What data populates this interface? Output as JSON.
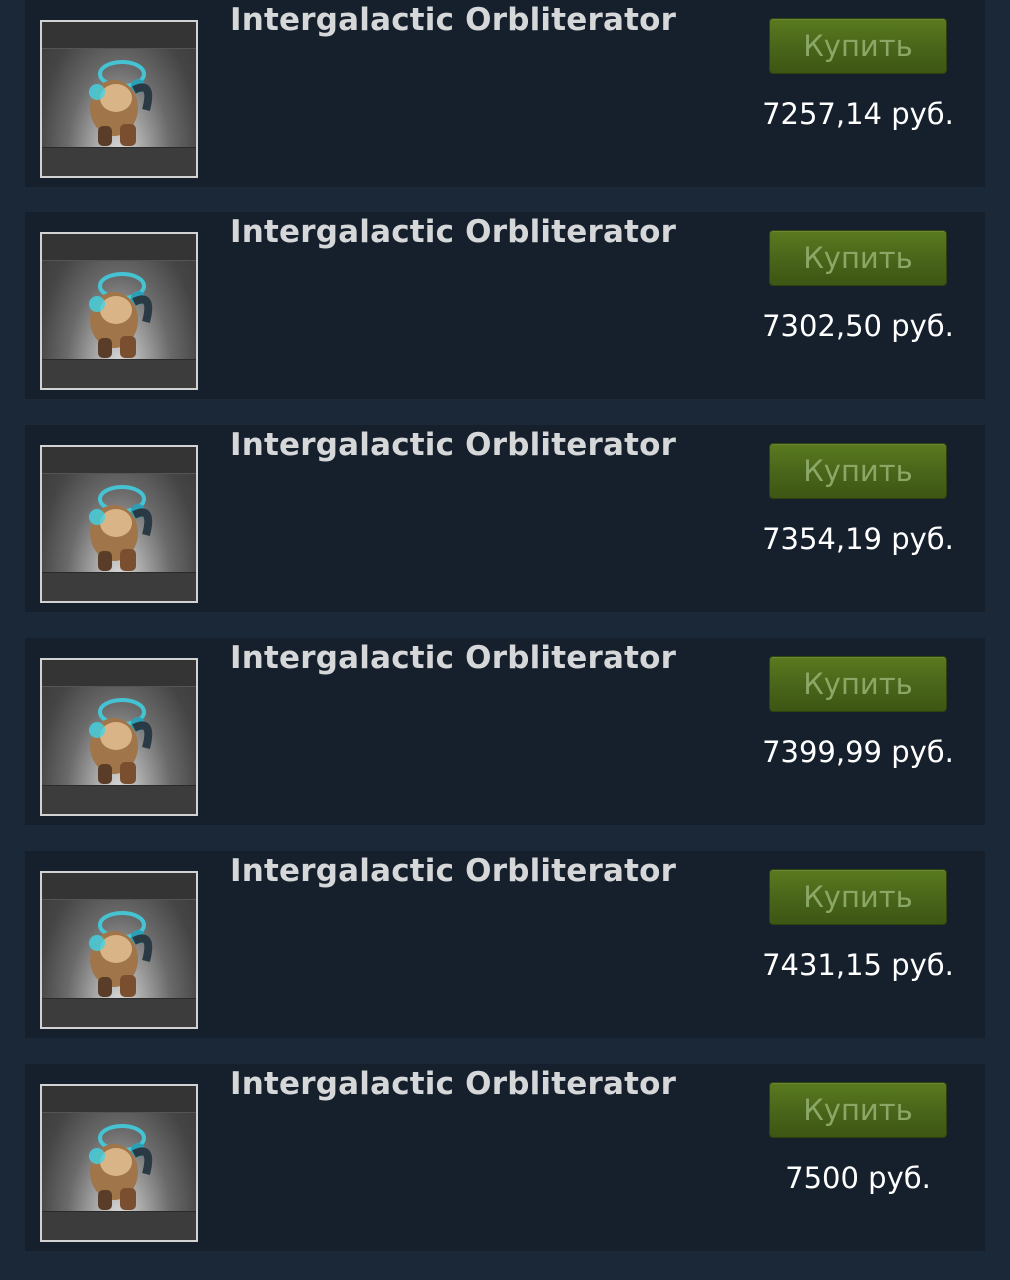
{
  "listings": [
    {
      "name": "Intergalactic Orbliterator",
      "buy_label": "Купить",
      "price": "7257,14 руб."
    },
    {
      "name": "Intergalactic Orbliterator",
      "buy_label": "Купить",
      "price": "7302,50 руб."
    },
    {
      "name": "Intergalactic Orbliterator",
      "buy_label": "Купить",
      "price": "7354,19 руб."
    },
    {
      "name": "Intergalactic Orbliterator",
      "buy_label": "Купить",
      "price": "7399,99 руб."
    },
    {
      "name": "Intergalactic Orbliterator",
      "buy_label": "Купить",
      "price": "7431,15 руб."
    },
    {
      "name": "Intergalactic Orbliterator",
      "buy_label": "Купить",
      "price": "7500 руб."
    }
  ],
  "colors": {
    "page_background": "#1b2838",
    "row_background": "#16202d",
    "buy_button": "#4a661a",
    "buy_button_text": "#8aa765",
    "item_name": "#d6d7d8",
    "price_text": "#ffffff",
    "item_glow": "#3fd4e6"
  },
  "icons": {
    "item_image": "item-thumbnail-icon"
  }
}
